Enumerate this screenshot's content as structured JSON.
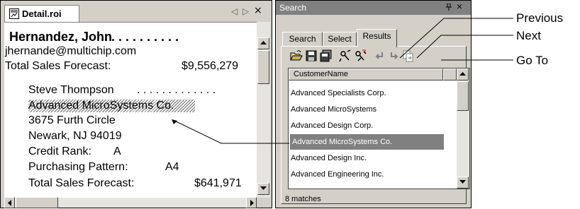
{
  "detail_window": {
    "tab_label": "Detail.roi",
    "nav_prev_glyph": "◁",
    "nav_next_glyph": "▷",
    "close_glyph": "×",
    "record1": {
      "name": "Hernandez, John",
      "leader": ". . . . . . . . . . .",
      "email": "jhernande@multichip.com",
      "forecast_label": "Total Sales Forecast:",
      "forecast_value": "$9,556,279"
    },
    "record2": {
      "name": "Steve  Thompson",
      "leader": ". . . . . . . . . . . . .",
      "company": "Advanced MicroSystems Co.",
      "street": "3675 Furth Circle",
      "city": "Newark, NJ  94019",
      "credit_label": "Credit Rank:",
      "credit_value": "A",
      "pattern_label": "Purchasing Pattern:",
      "pattern_value": "A4",
      "forecast_label": "Total Sales Forecast:",
      "forecast_value": "$641,971"
    }
  },
  "search_pane": {
    "title": "Search",
    "pin_glyph": "ᵖ",
    "close_glyph": "×",
    "tabs": [
      {
        "label": "Search",
        "active": false
      },
      {
        "label": "Select",
        "active": false
      },
      {
        "label": "Results",
        "active": true
      }
    ],
    "toolbar_icons": [
      "open-icon",
      "save-icon",
      "save-all-icon",
      "find-icon",
      "find-next-icon",
      "previous-icon",
      "next-icon",
      "go-to-icon"
    ],
    "grid": {
      "column_header": "CustomerName",
      "rows": [
        {
          "name": "Advanced Specialists Corp.",
          "selected": false
        },
        {
          "name": "Advanced MicroSystems",
          "selected": false
        },
        {
          "name": "Advanced Design Corp.",
          "selected": false
        },
        {
          "name": "Advanced MicroSystems Co.",
          "selected": true
        },
        {
          "name": "Advanced Design Inc.",
          "selected": false
        },
        {
          "name": "Advanced Engineering Inc.",
          "selected": false
        }
      ]
    },
    "status": "8 matches"
  },
  "callouts": {
    "previous": "Previous",
    "next": "Next",
    "go_to": "Go To"
  }
}
